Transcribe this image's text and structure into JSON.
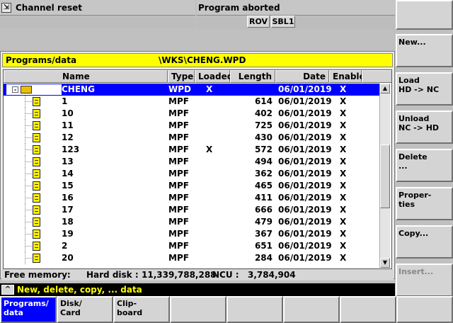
{
  "status": {
    "channel": "Channel reset",
    "program": "Program aborted",
    "flags": [
      "ROV",
      "SBL1"
    ]
  },
  "panel": {
    "title": "Programs/data",
    "path": "\\WKS\\CHENG.WPD"
  },
  "table": {
    "columns": [
      "Name",
      "Type",
      "Loaded",
      "Length",
      "Date",
      "Enable"
    ],
    "rows": [
      {
        "name": "CHENG",
        "type": "WPD",
        "loaded": "X",
        "length": "",
        "date": "06/01/2019",
        "enable": "X"
      },
      {
        "name": "1",
        "type": "MPF",
        "loaded": "",
        "length": "614",
        "date": "06/01/2019",
        "enable": "X"
      },
      {
        "name": "10",
        "type": "MPF",
        "loaded": "",
        "length": "402",
        "date": "06/01/2019",
        "enable": "X"
      },
      {
        "name": "11",
        "type": "MPF",
        "loaded": "",
        "length": "725",
        "date": "06/01/2019",
        "enable": "X"
      },
      {
        "name": "12",
        "type": "MPF",
        "loaded": "",
        "length": "430",
        "date": "06/01/2019",
        "enable": "X"
      },
      {
        "name": "123",
        "type": "MPF",
        "loaded": "X",
        "length": "572",
        "date": "06/01/2019",
        "enable": "X"
      },
      {
        "name": "13",
        "type": "MPF",
        "loaded": "",
        "length": "494",
        "date": "06/01/2019",
        "enable": "X"
      },
      {
        "name": "14",
        "type": "MPF",
        "loaded": "",
        "length": "362",
        "date": "06/01/2019",
        "enable": "X"
      },
      {
        "name": "15",
        "type": "MPF",
        "loaded": "",
        "length": "465",
        "date": "06/01/2019",
        "enable": "X"
      },
      {
        "name": "16",
        "type": "MPF",
        "loaded": "",
        "length": "411",
        "date": "06/01/2019",
        "enable": "X"
      },
      {
        "name": "17",
        "type": "MPF",
        "loaded": "",
        "length": "666",
        "date": "06/01/2019",
        "enable": "X"
      },
      {
        "name": "18",
        "type": "MPF",
        "loaded": "",
        "length": "479",
        "date": "06/01/2019",
        "enable": "X"
      },
      {
        "name": "19",
        "type": "MPF",
        "loaded": "",
        "length": "367",
        "date": "06/01/2019",
        "enable": "X"
      },
      {
        "name": "2",
        "type": "MPF",
        "loaded": "",
        "length": "651",
        "date": "06/01/2019",
        "enable": "X"
      },
      {
        "name": "20",
        "type": "MPF",
        "loaded": "",
        "length": "284",
        "date": "06/01/2019",
        "enable": "X"
      }
    ],
    "selected_row": "CHENG"
  },
  "memory": {
    "label": "Free memory:",
    "hd_label": "Hard disk :",
    "hd_value": "11,339,788,288",
    "ncu_label": "NCU :",
    "ncu_value": "3,784,904"
  },
  "info": {
    "icon": "caret-up-icon",
    "text": "New, delete, copy, ... data"
  },
  "vertical_softkeys": [
    {
      "label": "",
      "enabled": true
    },
    {
      "label": "New...",
      "enabled": true
    },
    {
      "label": "Load\nHD -> NC",
      "enabled": true
    },
    {
      "label": "Unload\nNC -> HD",
      "enabled": true
    },
    {
      "label": "Delete\n...",
      "enabled": true
    },
    {
      "label": "Proper-\nties",
      "enabled": true
    },
    {
      "label": "Copy...",
      "enabled": true
    },
    {
      "label": "Insert...",
      "enabled": false
    }
  ],
  "horizontal_softkeys": [
    {
      "label": "Programs/\ndata",
      "active": true
    },
    {
      "label": "Disk/\nCard",
      "active": false
    },
    {
      "label": "Clip-\nboard",
      "active": false
    },
    {
      "label": "",
      "active": false
    },
    {
      "label": "",
      "active": false
    },
    {
      "label": "",
      "active": false
    },
    {
      "label": "",
      "active": false
    },
    {
      "label": "",
      "active": false
    }
  ],
  "colors": {
    "accent": "#0000ff",
    "title_bar": "#ffff00",
    "info_text": "#ffff00",
    "background": "#c0c0c0"
  }
}
